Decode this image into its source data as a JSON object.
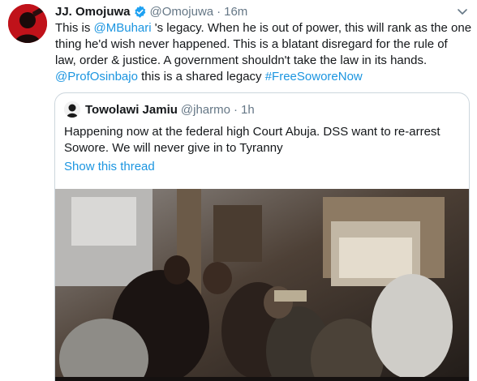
{
  "tweet": {
    "display_name": "JJ. Omojuwa",
    "verified": true,
    "handle": "@Omojuwa",
    "separator": "·",
    "time": "16m",
    "lines": [
      [
        {
          "t": "This is ",
          "link": false
        },
        {
          "t": "@MBuhari",
          "link": true
        },
        {
          "t": " 's legacy. When he is out of power, this will rank as the one",
          "link": false
        }
      ],
      [
        {
          "t": "thing he'd wish never happened. This is a blatant disregard for the rule of",
          "link": false
        }
      ],
      [
        {
          "t": "law, order & justice. A government shouldn't take the law in its hands.",
          "link": false
        }
      ],
      [
        {
          "t": "@ProfOsinbajo",
          "link": true
        },
        {
          "t": " this is a shared legacy ",
          "link": false
        },
        {
          "t": "#FreeSoworeNow",
          "link": true
        }
      ]
    ],
    "menu_icon": "chevron-down-icon",
    "avatar_icon": "profile-avatar"
  },
  "quoted_tweet": {
    "display_name": "Towolawi Jamiu",
    "handle": "@jharmo",
    "separator": "·",
    "time": "1h",
    "lines": [
      "Happening now at the federal high Court Abuja. DSS want to re-arrest",
      "Sowore. We will never give in to Tyranny"
    ],
    "show_thread_label": "Show this thread",
    "media_description_icon": "video-thumbnail"
  },
  "colors": {
    "link": "#1b95e0",
    "verified": "#1da1f2",
    "muted": "#657786",
    "border": "#ccd6dd",
    "avatar_bg": "#c0121a"
  }
}
